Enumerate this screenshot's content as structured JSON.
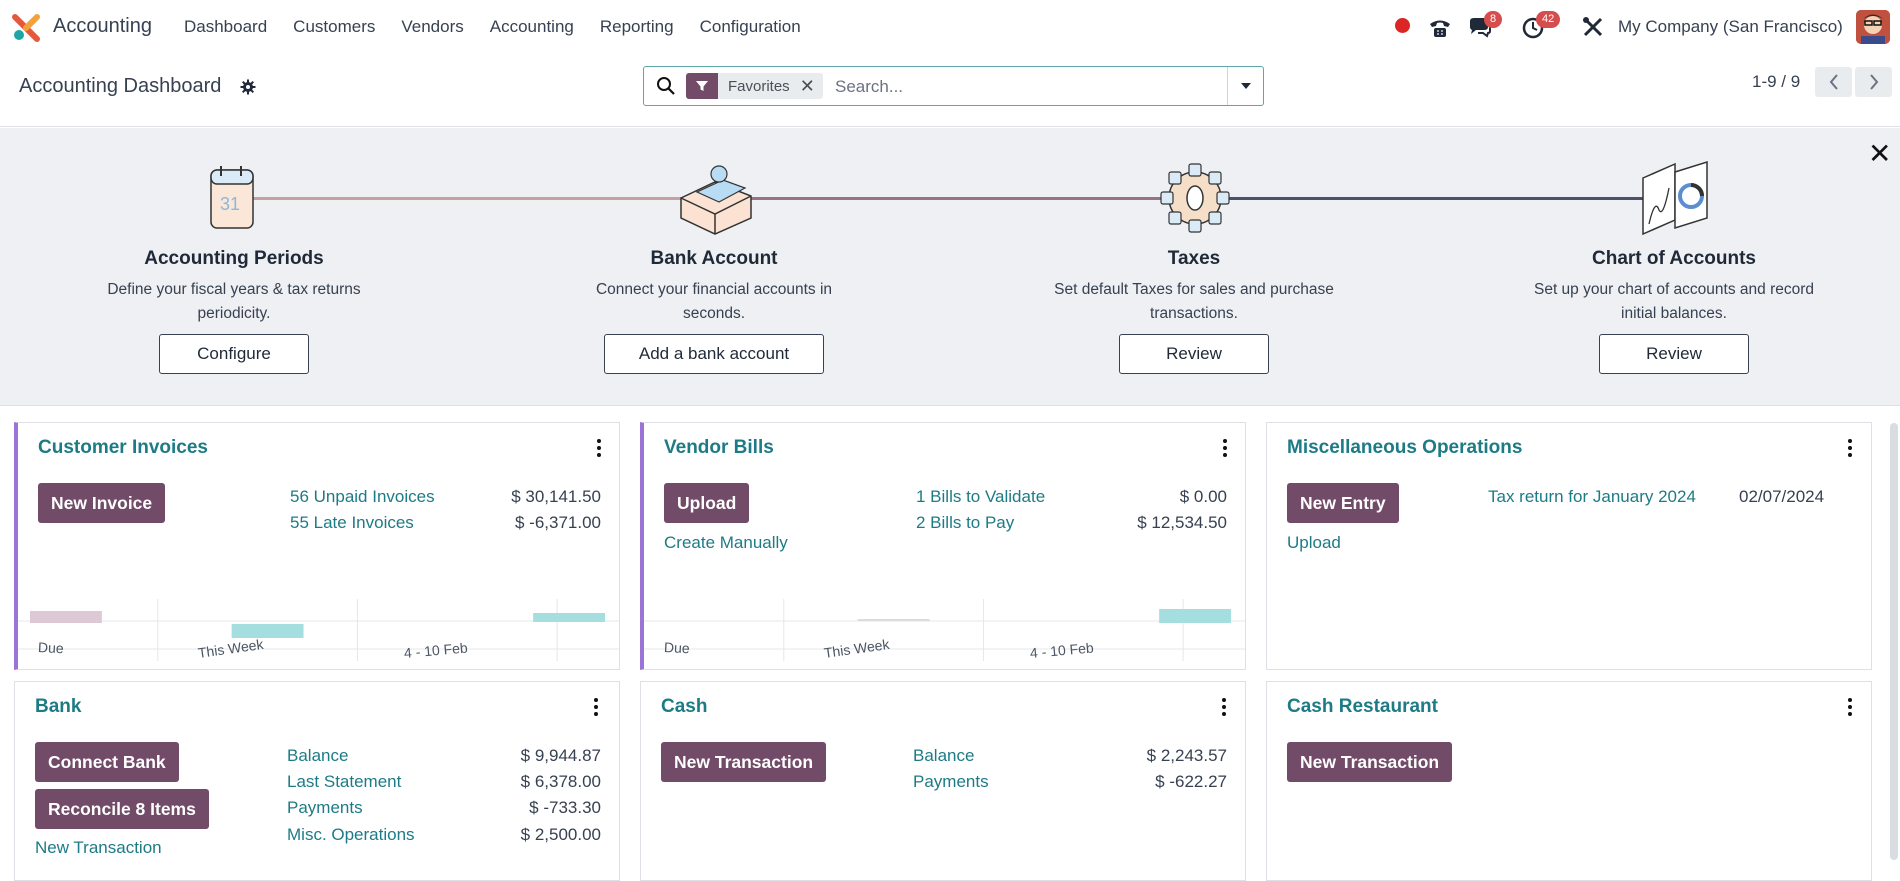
{
  "navbar": {
    "app_name": "Accounting",
    "menu": [
      "Dashboard",
      "Customers",
      "Vendors",
      "Accounting",
      "Reporting",
      "Configuration"
    ],
    "messages_badge": "8",
    "activities_badge": "42",
    "company": "My Company (San Francisco)"
  },
  "control_panel": {
    "title": "Accounting Dashboard",
    "facet_label": "Favorites",
    "search_placeholder": "Search...",
    "pager": "1-9 / 9"
  },
  "onboarding": {
    "steps": [
      {
        "title": "Accounting Periods",
        "desc": "Define your fiscal years & tax returns periodicity.",
        "button": "Configure"
      },
      {
        "title": "Bank Account",
        "desc": "Connect your financial accounts in seconds.",
        "button": "Add a bank account"
      },
      {
        "title": "Taxes",
        "desc": "Set default Taxes for sales and purchase transactions.",
        "button": "Review"
      },
      {
        "title": "Chart of Accounts",
        "desc": "Set up your chart of accounts and record initial balances.",
        "button": "Review"
      }
    ]
  },
  "cards": {
    "customer_invoices": {
      "title": "Customer Invoices",
      "button": "New Invoice",
      "rows": [
        {
          "label": "56 Unpaid Invoices",
          "amount": "$ 30,141.50"
        },
        {
          "label": "55 Late Invoices",
          "amount": "$ -6,371.00"
        }
      ],
      "chart_labels": [
        "Due",
        "This Week",
        "4 - 10 Feb"
      ]
    },
    "vendor_bills": {
      "title": "Vendor Bills",
      "button": "Upload",
      "link": "Create Manually",
      "rows": [
        {
          "label": "1 Bills to Validate",
          "amount": "$ 0.00"
        },
        {
          "label": "2 Bills to Pay",
          "amount": "$ 12,534.50"
        }
      ],
      "chart_labels": [
        "Due",
        "This Week",
        "4 - 10 Feb"
      ]
    },
    "misc": {
      "title": "Miscellaneous Operations",
      "button": "New Entry",
      "link": "Upload",
      "tax_label": "Tax return for January 2024",
      "tax_date": "02/07/2024"
    },
    "bank": {
      "title": "Bank",
      "button1": "Connect Bank",
      "button2": "Reconcile 8 Items",
      "link": "New Transaction",
      "rows": [
        {
          "label": "Balance",
          "amount": "$ 9,944.87"
        },
        {
          "label": "Last Statement",
          "amount": "$ 6,378.00"
        },
        {
          "label": "Payments",
          "amount": "$ -733.30"
        },
        {
          "label": "Misc. Operations",
          "amount": "$ 2,500.00"
        }
      ]
    },
    "cash": {
      "title": "Cash",
      "button": "New Transaction",
      "rows": [
        {
          "label": "Balance",
          "amount": "$ 2,243.57"
        },
        {
          "label": "Payments",
          "amount": "$ -622.27"
        }
      ]
    },
    "cash_restaurant": {
      "title": "Cash Restaurant",
      "button": "New Transaction"
    }
  },
  "colors": {
    "primary": "#714b67",
    "link": "#1d7b86",
    "accent_border": "#9b74d8",
    "bar_teal": "#a5dede",
    "bar_mauve": "#dcc9d5"
  }
}
